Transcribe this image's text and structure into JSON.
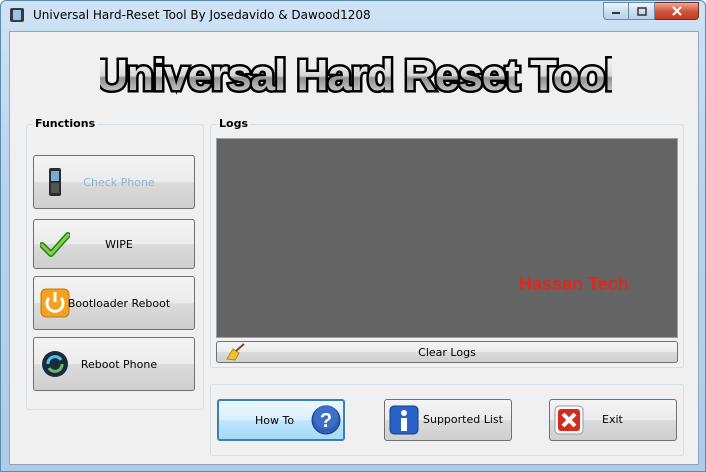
{
  "window": {
    "title": "Universal Hard-Reset Tool By Josedavido & Dawood1208"
  },
  "logo": {
    "text": "Universal Hard Reset Tool"
  },
  "functions": {
    "label": "Functions",
    "buttons": [
      {
        "label": "Check Phone",
        "icon": "phone-icon",
        "enabled": false
      },
      {
        "label": "WIPE",
        "icon": "checkmark-icon",
        "enabled": true
      },
      {
        "label": "Bootloader Reboot",
        "icon": "reboot-arrow-icon",
        "enabled": true
      },
      {
        "label": "Reboot Phone",
        "icon": "sync-icon",
        "enabled": true
      }
    ]
  },
  "logs": {
    "label": "Logs",
    "watermark": "Hassan Tech",
    "clear_label": "Clear Logs"
  },
  "actions": {
    "how_to_label": "How To",
    "supported_label": "Supported List",
    "exit_label": "Exit"
  },
  "colors": {
    "logs_background": "#646464",
    "watermark": "#e0291c",
    "logo_blue": "#2c3fd8"
  }
}
